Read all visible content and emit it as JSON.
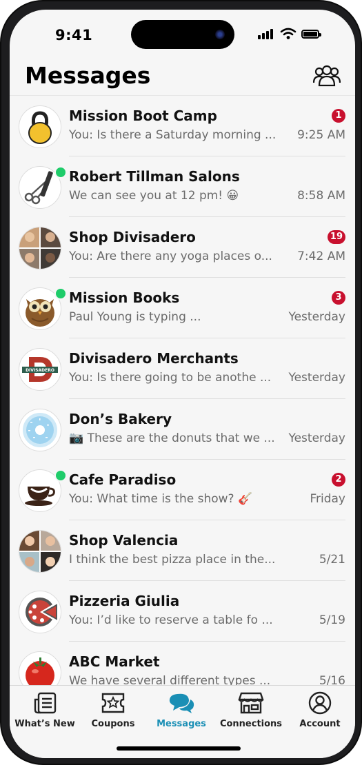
{
  "status": {
    "time": "9:41"
  },
  "header": {
    "title": "Messages",
    "people_icon": "group-people-icon"
  },
  "conversations": [
    {
      "name": "Mission Boot Camp",
      "preview": "You: Is there a Saturday morning ...",
      "time": "9:25 AM",
      "badge": "1",
      "avatar": "kettlebell"
    },
    {
      "name": "Robert Tillman Salons",
      "preview": "We can see you at 12 pm! 😀",
      "time": "8:58 AM",
      "badge": "",
      "avatar": "scissors-comb",
      "online": true
    },
    {
      "name": "Shop Divisadero",
      "preview": "You: Are there any yoga places o...",
      "time": "7:42 AM",
      "badge": "19",
      "avatar": "group-photo"
    },
    {
      "name": "Mission Books",
      "preview": "Paul Young is typing ...",
      "time": "Yesterday",
      "badge": "3",
      "avatar": "owl",
      "online": true
    },
    {
      "name": "Divisadero Merchants",
      "preview": "You: Is there going to be anothe ...",
      "time": "Yesterday",
      "badge": "",
      "avatar": "d-logo"
    },
    {
      "name": "Don’s Bakery",
      "preview": "📷 These are the donuts that we ...",
      "time": "Yesterday",
      "badge": "",
      "avatar": "donut"
    },
    {
      "name": "Cafe Paradiso",
      "preview": "You: What time is the show? 🎸",
      "time": "Friday",
      "badge": "2",
      "avatar": "coffee-cup",
      "online": true
    },
    {
      "name": "Shop Valencia",
      "preview": "I think the best pizza place in the...",
      "time": "5/21",
      "badge": "",
      "avatar": "group-photo"
    },
    {
      "name": "Pizzeria Giulia",
      "preview": "You: I’d like to reserve a table fo ...",
      "time": "5/19",
      "badge": "",
      "avatar": "pizza"
    },
    {
      "name": "ABC Market",
      "preview": "We have several different types ...",
      "time": "5/16",
      "badge": "",
      "avatar": "tomato"
    }
  ],
  "tabs": [
    {
      "label": "What’s New",
      "icon": "news-icon"
    },
    {
      "label": "Coupons",
      "icon": "star-coupon-icon"
    },
    {
      "label": "Messages",
      "icon": "chat-bubbles-icon",
      "active": true
    },
    {
      "label": "Connections",
      "icon": "storefront-icon"
    },
    {
      "label": "Account",
      "icon": "user-circle-icon"
    }
  ],
  "colors": {
    "accent": "#1a8fb5",
    "badge": "#c8102e",
    "online": "#1fcc6a"
  },
  "divisadero_logo_text": "DIVISADERO"
}
